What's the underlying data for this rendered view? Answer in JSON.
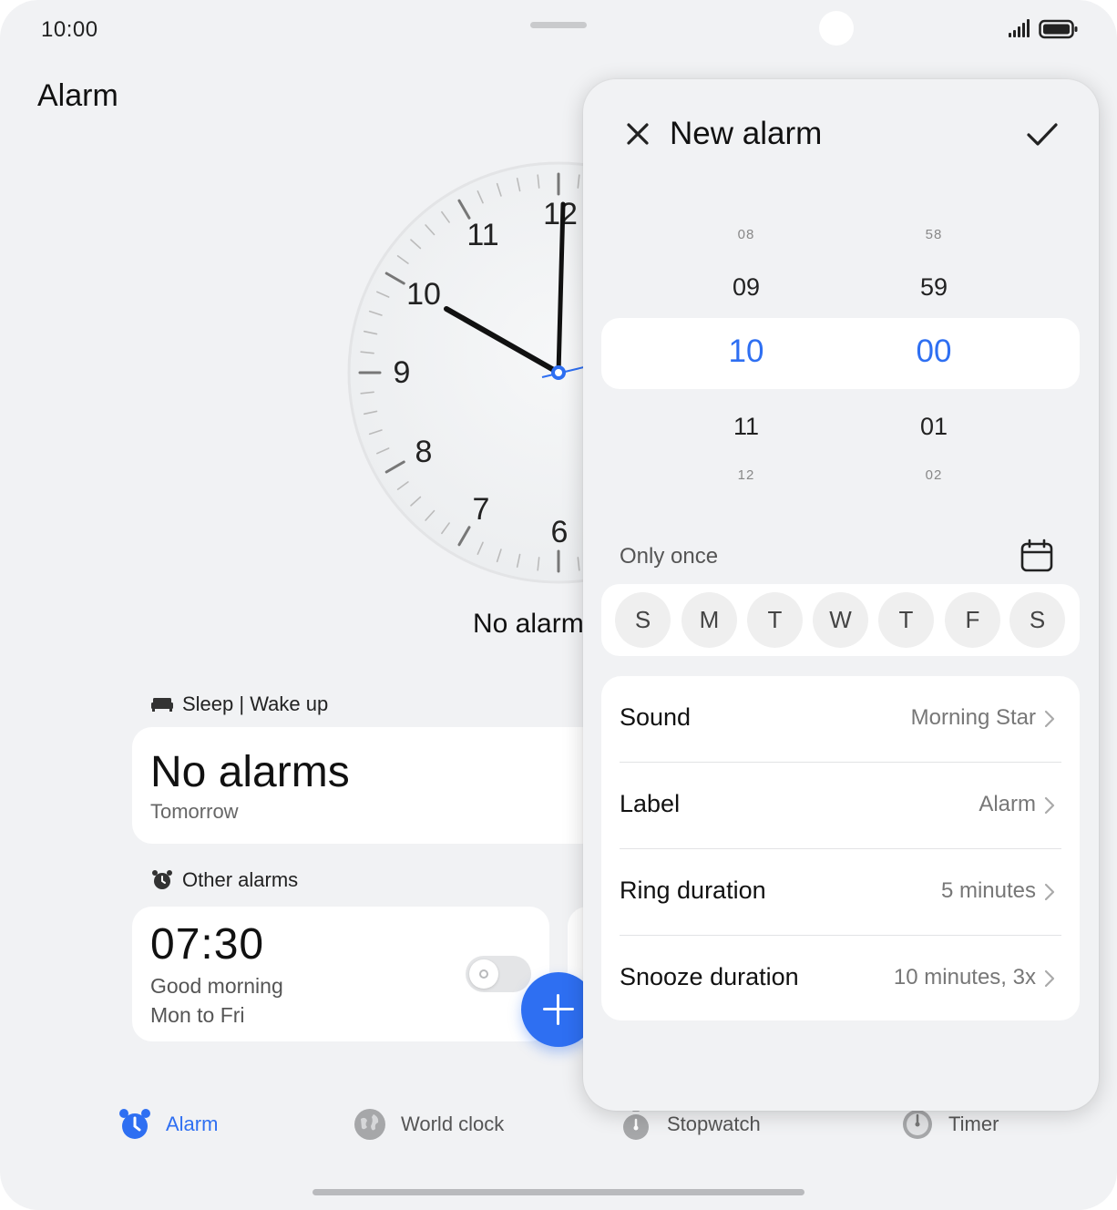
{
  "status_bar": {
    "time": "10:00",
    "signal_icon": "signal-icon",
    "battery_icon": "battery-icon"
  },
  "page": {
    "title": "Alarm"
  },
  "clock": {
    "numerals": [
      "12",
      "11",
      "10",
      "9",
      "8",
      "7",
      "6"
    ],
    "hour_hand_time": "10:00",
    "caption": "No alarm"
  },
  "sleep": {
    "section_label": "Sleep | Wake up",
    "icon": "bed-icon",
    "title": "No alarms",
    "subtitle": "Tomorrow"
  },
  "other_alarms": {
    "section_label": "Other alarms",
    "icon": "alarm-clock-icon",
    "items": [
      {
        "time": "07:30",
        "name": "Good morning",
        "days": "Mon to Fri",
        "enabled": false
      }
    ]
  },
  "fab": {
    "icon": "plus-icon"
  },
  "bottom_nav": {
    "items": [
      {
        "label": "Alarm",
        "icon": "alarm-clock-icon",
        "active": true
      },
      {
        "label": "World clock",
        "icon": "globe-icon",
        "active": false
      },
      {
        "label": "Stopwatch",
        "icon": "stopwatch-icon",
        "active": false
      },
      {
        "label": "Timer",
        "icon": "timer-icon",
        "active": false
      }
    ]
  },
  "new_alarm": {
    "title": "New alarm",
    "close_icon": "close-icon",
    "confirm_icon": "check-icon",
    "hours": [
      "08",
      "09",
      "10",
      "11",
      "12"
    ],
    "minutes": [
      "58",
      "59",
      "00",
      "01",
      "02"
    ],
    "selected_hour": "10",
    "selected_minute": "00",
    "repeat": "Only once",
    "calendar_icon": "calendar-icon",
    "days": [
      "S",
      "M",
      "T",
      "W",
      "T",
      "F",
      "S"
    ],
    "settings": [
      {
        "label": "Sound",
        "value": "Morning Star"
      },
      {
        "label": "Label",
        "value": "Alarm"
      },
      {
        "label": "Ring duration",
        "value": "5 minutes"
      },
      {
        "label": "Snooze duration",
        "value": "10 minutes, 3x"
      }
    ]
  },
  "colors": {
    "accent": "#2e6ff2",
    "background": "#f1f2f4",
    "card": "#ffffff"
  }
}
